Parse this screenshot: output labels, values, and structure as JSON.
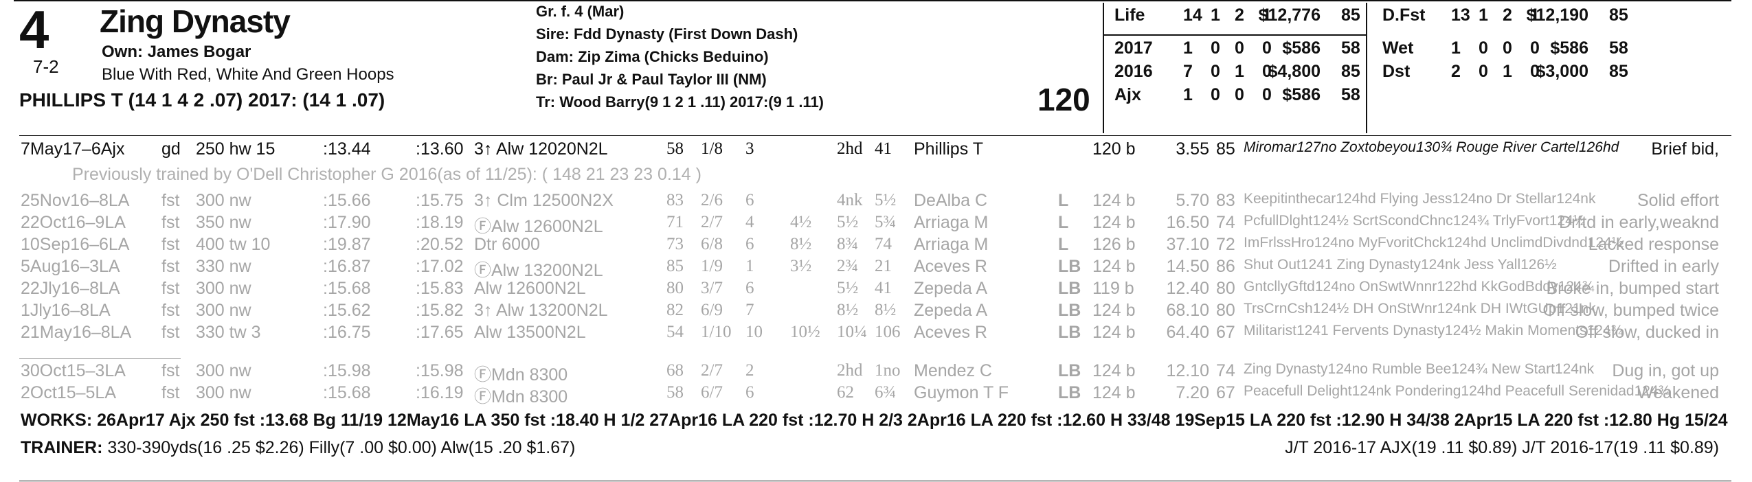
{
  "entry": {
    "pp": "4",
    "odds": "7-2",
    "name": "Zing Dynasty",
    "owner": "Own: James Bogar",
    "silks": "Blue With Red, White And Green Hoops",
    "jockey": "PHILLIPS T (14 1 4 2 .07) 2017: (14 1 .07)",
    "sex_age": "Gr. f. 4 (Mar)",
    "sire": "Sire: Fdd Dynasty (First Down Dash)",
    "dam": "Dam: Zip Zima (Chicks Beduino)",
    "breeder": "Br:   Paul Jr & Paul Taylor III (NM)",
    "trainer": "Tr:   Wood Barry(9 1 2 1 .11)  2017:(9 1 .11)",
    "weight": "120"
  },
  "stats_left": [
    {
      "label": "Life",
      "s": "14",
      "w": "1",
      "p": "2",
      "sh": "1",
      "earn": "$12,776",
      "speed": "85"
    },
    {
      "label": "2017",
      "s": "1",
      "w": "0",
      "p": "0",
      "sh": "0",
      "earn": "$586",
      "speed": "58"
    },
    {
      "label": "2016",
      "s": "7",
      "w": "0",
      "p": "1",
      "sh": "0",
      "earn": "$4,800",
      "speed": "85"
    },
    {
      "label": "Ajx",
      "s": "1",
      "w": "0",
      "p": "0",
      "sh": "0",
      "earn": "$586",
      "speed": "58"
    }
  ],
  "stats_right": [
    {
      "label": "D.Fst",
      "s": "13",
      "w": "1",
      "p": "2",
      "sh": "1",
      "earn": "$12,190",
      "speed": "85"
    },
    {
      "label": "Wet",
      "s": "1",
      "w": "0",
      "p": "0",
      "sh": "0",
      "earn": "$586",
      "speed": "58"
    },
    {
      "label": "Dst",
      "s": "2",
      "w": "0",
      "p": "1",
      "sh": "0",
      "earn": "$3,000",
      "speed": "85"
    }
  ],
  "prev_trainer": "Previously trained by O'Dell Christopher G 2016(as of 11/25): ( 148 21 23 23 0.14 )",
  "races": [
    {
      "date": "7May17–6Ajx",
      "trk": "gd",
      "dist": "250 hw 15",
      "f1": ":13.44",
      "f2": ":13.60",
      "cls": "3↑ Alw 12020N2L",
      "spd": "58",
      "pp": "1/8",
      "st": "3",
      "c1": "",
      "c2": "2hd",
      "fin": "41",
      "jky": "Phillips T",
      "med": "",
      "wt": "120 b",
      "odds": "3.55",
      "sr": "85",
      "comp": "Miromar127no Zoxtobeyou130¾ Rouge River Cartel126hd",
      "cmt": "Brief bid,"
    },
    {
      "date": "25Nov16–8LA",
      "trk": "fst",
      "dist": "300 nw",
      "f1": ":15.66",
      "f2": ":15.75",
      "cls": "3↑ Clm 12500N2X",
      "spd": "83",
      "pp": "2/6",
      "st": "6",
      "c1": "",
      "c2": "4nk",
      "fin": "5½",
      "jky": "DeAlba C",
      "med": "L",
      "wt": "124 b",
      "odds": "5.70",
      "sr": "83",
      "comp": "Keepitinthecar124hd Flying Jess124no Dr Stellar124nk",
      "cmt": "Solid effort"
    },
    {
      "date": "22Oct16–9LA",
      "trk": "fst",
      "dist": "350 nw",
      "f1": ":17.90",
      "f2": ":18.19",
      "cls": "ⒻAlw 12600N2L",
      "spd": "71",
      "pp": "2/7",
      "st": "4",
      "c1": "4½",
      "c2": "5½",
      "fin": "5¾",
      "jky": "Arriaga M",
      "med": "L",
      "wt": "124 b",
      "odds": "16.50",
      "sr": "74",
      "comp": "PcfullDlght124½ ScrtScondChnc124¾ TrlyFvort124½",
      "cmt": "Drftd in early,weaknd"
    },
    {
      "date": "10Sep16–6LA",
      "trk": "fst",
      "dist": "400 tw 10",
      "f1": ":19.87",
      "f2": ":20.52",
      "cls": "Dtr 6000",
      "spd": "73",
      "pp": "6/8",
      "st": "6",
      "c1": "8½",
      "c2": "8¾",
      "fin": "74",
      "jky": "Arriaga M",
      "med": "L",
      "wt": "126 b",
      "odds": "37.10",
      "sr": "72",
      "comp": "ImFrlssHro124no MyFvoritChck124hd UnclimdDivdnd124½",
      "cmt": "Lacked response"
    },
    {
      "date": "5Aug16–3LA",
      "trk": "fst",
      "dist": "330 nw",
      "f1": ":16.87",
      "f2": ":17.02",
      "cls": "ⒻAlw 13200N2L",
      "spd": "85",
      "pp": "1/9",
      "st": "1",
      "c1": "3½",
      "c2": "2¾",
      "fin": "21",
      "jky": "Aceves R",
      "med": "LB",
      "wt": "124 b",
      "odds": "14.50",
      "sr": "86",
      "comp": "Shut Out1241 Zing Dynasty124nk Jess Yall126½",
      "cmt": "Drifted in early"
    },
    {
      "date": "22Jly16–8LA",
      "trk": "fst",
      "dist": "300 nw",
      "f1": ":15.68",
      "f2": ":15.83",
      "cls": "Alw 12600N2L",
      "spd": "80",
      "pp": "3/7",
      "st": "6",
      "c1": "",
      "c2": "5½",
      "fin": "41",
      "jky": "Zepeda A",
      "med": "LB",
      "wt": "119 b",
      "odds": "12.40",
      "sr": "80",
      "comp": "GntcllyGftd124no OnSwtWnnr122hd KkGodBddy124¾",
      "cmt": "Broke in, bumped start"
    },
    {
      "date": "1Jly16–8LA",
      "trk": "fst",
      "dist": "300 nw",
      "f1": ":15.62",
      "f2": ":15.82",
      "cls": "3↑ Alw 13200N2L",
      "spd": "82",
      "pp": "6/9",
      "st": "7",
      "c1": "",
      "c2": "8½",
      "fin": "8½",
      "jky": "Zepeda A",
      "med": "LB",
      "wt": "124 b",
      "odds": "68.10",
      "sr": "80",
      "comp": "TrsCrnCsh124½ DH OnStWnr124nk DH IWtGUp121nk",
      "cmt": "Off slow, bumped twice"
    },
    {
      "date": "21May16–8LA",
      "trk": "fst",
      "dist": "330 tw 3",
      "f1": ":16.75",
      "f2": ":17.65",
      "cls": "Alw 13500N2L",
      "spd": "54",
      "pp": "1/10",
      "st": "10",
      "c1": "10½",
      "c2": "10¼",
      "fin": "106",
      "jky": "Aceves R",
      "med": "LB",
      "wt": "124 b",
      "odds": "64.40",
      "sr": "67",
      "comp": "Militarist1241 Fervents Dynasty124½ Makin Moments124¾",
      "cmt": "Off slow, ducked in"
    },
    {
      "date": "30Oct15–3LA",
      "trk": "fst",
      "dist": "300 nw",
      "f1": ":15.98",
      "f2": ":15.98",
      "cls": "ⒻMdn 8300",
      "spd": "68",
      "pp": "2/7",
      "st": "2",
      "c1": "",
      "c2": "2hd",
      "fin": "1no",
      "jky": "Mendez C",
      "med": "LB",
      "wt": "124 b",
      "odds": "12.10",
      "sr": "74",
      "comp": "Zing Dynasty124no Rumble Bee124¾ New Start124nk",
      "cmt": "Dug in, got up"
    },
    {
      "date": "2Oct15–5LA",
      "trk": "fst",
      "dist": "300 nw",
      "f1": ":15.68",
      "f2": ":16.19",
      "cls": "ⒻMdn 8300",
      "spd": "58",
      "pp": "6/7",
      "st": "6",
      "c1": "",
      "c2": "62",
      "fin": "6¾",
      "jky": "Guymon T F",
      "med": "LB",
      "wt": "124 b",
      "odds": "7.20",
      "sr": "67",
      "comp": "Peacefull Delight124nk Pondering124hd Peacefull Serenidad124¾",
      "cmt": "Weakened"
    }
  ],
  "works": "WORKS:    26Apr17 Ajx 250 fst  :13.68 Bg 11/19    12May16 LA  350 fst  :18.40 H  1/2    27Apr16 LA  220 fst  :12.70 H  2/3    2Apr16 LA  220 fst  :12.60 H  33/48    19Sep15 LA  220 fst  :12.90 H  34/38    2Apr15 LA  220 fst  :12.80 Hg  15/24",
  "trainer_stats_label": "TRAINER:",
  "trainer_stats": " 330-390yds(16 .25 $2.26) Filly(7 .00 $0.00) Alw(15 .20 $1.67)",
  "jt_stats": "J/T 2016-17 AJX(19 .11 $0.89)  J/T 2016-17(19 .11 $0.89)"
}
